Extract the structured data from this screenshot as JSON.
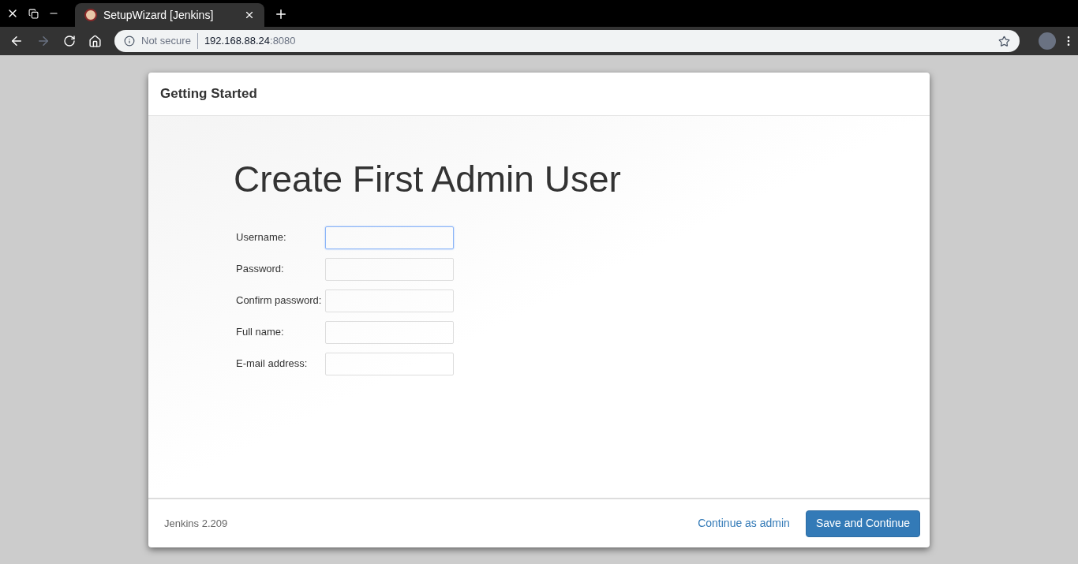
{
  "browser": {
    "tab": {
      "title": "SetupWizard [Jenkins]",
      "selected": true
    },
    "address": {
      "security": "Not secure",
      "host": "192.168.88.24",
      "port": ":8080"
    }
  },
  "dialog": {
    "header": "Getting Started",
    "heading": "Create First Admin User",
    "fields": [
      {
        "label": "Username:",
        "focused": true
      },
      {
        "label": "Password:",
        "focused": false
      },
      {
        "label": "Confirm password:",
        "focused": false
      },
      {
        "label": "Full name:",
        "focused": false
      },
      {
        "label": "E-mail address:",
        "focused": false
      }
    ],
    "version": "Jenkins 2.209",
    "link": "Continue as admin",
    "button": "Save and Continue"
  }
}
